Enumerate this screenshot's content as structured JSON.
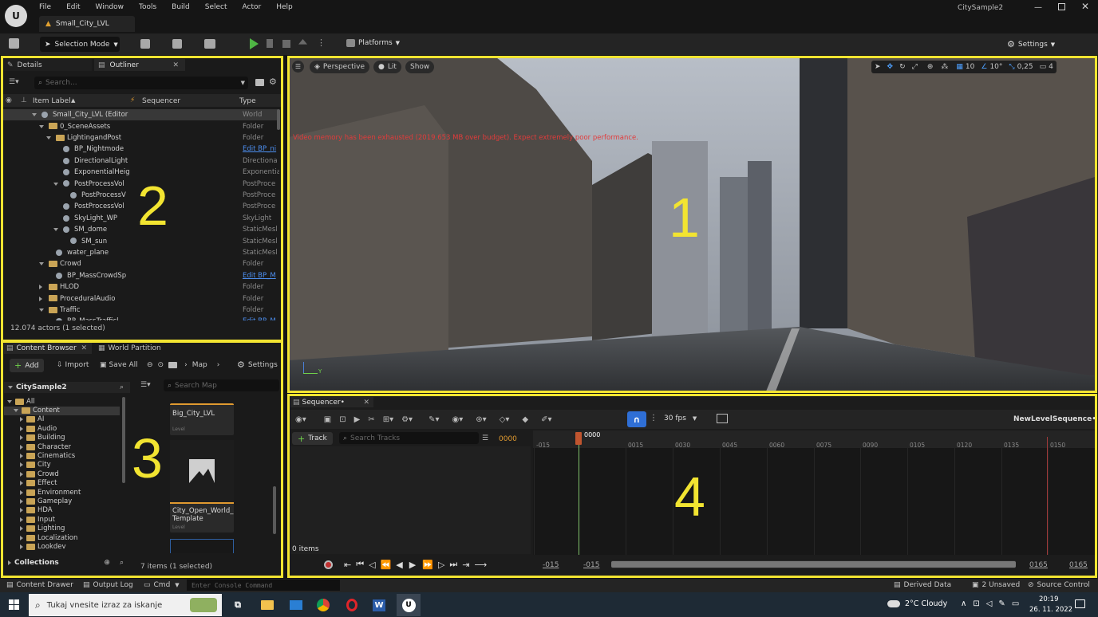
{
  "app": {
    "project_name": "CitySample2",
    "level_tab": "Small_City_LVL"
  },
  "menu": [
    "File",
    "Edit",
    "Window",
    "Tools",
    "Build",
    "Select",
    "Actor",
    "Help"
  ],
  "toolbar": {
    "selection_mode": "Selection Mode",
    "platforms": "Platforms",
    "settings": "Settings"
  },
  "left_panel": {
    "tabs": [
      "Details",
      "Outliner"
    ],
    "search_placeholder": "Search...",
    "columns": [
      "Item Label",
      "Sequencer",
      "Type"
    ],
    "rows": [
      {
        "label": "Small_City_LVL (Editor",
        "type": "World",
        "indent": 0,
        "link": false
      },
      {
        "label": "0_SceneAssets",
        "type": "Folder",
        "indent": 1,
        "link": false
      },
      {
        "label": "LightingandPost",
        "type": "Folder",
        "indent": 2,
        "link": false
      },
      {
        "label": "BP_Nightmode",
        "type": "Edit BP_ni",
        "indent": 3,
        "link": true
      },
      {
        "label": "DirectionalLight",
        "type": "Directiona",
        "indent": 3,
        "link": false
      },
      {
        "label": "ExponentialHeig",
        "type": "Exponentia",
        "indent": 3,
        "link": false
      },
      {
        "label": "PostProcessVol",
        "type": "PostProce",
        "indent": 3,
        "link": false
      },
      {
        "label": "PostProcessV",
        "type": "PostProce",
        "indent": 4,
        "link": false
      },
      {
        "label": "PostProcessVol",
        "type": "PostProce",
        "indent": 3,
        "link": false
      },
      {
        "label": "SkyLight_WP",
        "type": "SkyLight",
        "indent": 3,
        "link": false
      },
      {
        "label": "SM_dome",
        "type": "StaticMesl",
        "indent": 3,
        "link": false
      },
      {
        "label": "SM_sun",
        "type": "StaticMesl",
        "indent": 4,
        "link": false
      },
      {
        "label": "water_plane",
        "type": "StaticMesl",
        "indent": 2,
        "link": false
      },
      {
        "label": "Crowd",
        "type": "Folder",
        "indent": 1,
        "link": false
      },
      {
        "label": "BP_MassCrowdSp",
        "type": "Edit BP_M",
        "indent": 2,
        "link": true
      },
      {
        "label": "HLOD",
        "type": "Folder",
        "indent": 1,
        "link": false
      },
      {
        "label": "ProceduralAudio",
        "type": "Folder",
        "indent": 1,
        "link": false
      },
      {
        "label": "Traffic",
        "type": "Folder",
        "indent": 1,
        "link": false
      },
      {
        "label": "BP_MassTrafficl",
        "type": "Edit BP_M",
        "indent": 2,
        "link": true
      }
    ],
    "status": "12.074 actors (1 selected)"
  },
  "viewport": {
    "perspective": "Perspective",
    "lit": "Lit",
    "show": "Show",
    "warning": "Video memory has been exhausted (2019.653 MB over budget). Expect extremely poor performance.",
    "grid_snap": "10",
    "rot_snap": "10°",
    "scale_snap": "0,25",
    "cam_speed": "4",
    "label": "1"
  },
  "content_browser": {
    "tabs": [
      "Content Browser",
      "World Partition"
    ],
    "add": "Add",
    "import": "Import",
    "save_all": "Save All",
    "path": "Map",
    "settings": "Settings",
    "root": "CitySample2",
    "search_placeholder": "Search Map",
    "tree": [
      "All",
      "Content",
      "AI",
      "Audio",
      "Building",
      "Character",
      "Cinematics",
      "City",
      "Crowd",
      "Effect",
      "Environment",
      "Gameplay",
      "HDA",
      "Input",
      "Lighting",
      "Localization",
      "Lookdev"
    ],
    "collections": "Collections",
    "assets": [
      {
        "name": "Big_City_LVL",
        "type": "Level"
      },
      {
        "name": "City_Open_World_ Template",
        "type": "Level"
      }
    ],
    "status": "7 items (1 selected)",
    "label": "3"
  },
  "sequencer": {
    "tab": "Sequencer•",
    "fps": "30 fps",
    "sequence_name": "NewLevelSequence•",
    "track_btn": "Track",
    "search_placeholder": "Search Tracks",
    "frame": "0000",
    "playhead": "0000",
    "ticks": [
      "-015",
      "0015",
      "0030",
      "0045",
      "0060",
      "0075",
      "0090",
      "0105",
      "0120",
      "0135",
      "0150"
    ],
    "items": "0 items",
    "range_start": "-015",
    "range_start2": "-015",
    "range_end": "0165",
    "range_end2": "0165",
    "label": "4"
  },
  "outliner_label": "2",
  "status_bar": {
    "content_drawer": "Content Drawer",
    "output_log": "Output Log",
    "cmd": "Cmd",
    "console_placeholder": "Enter Console Command",
    "derived_data": "Derived Data",
    "unsaved": "2 Unsaved",
    "source_control": "Source Control"
  },
  "taskbar": {
    "search_placeholder": "Tukaj vnesite izraz za iskanje",
    "weather": "2°C  Cloudy",
    "time": "20:19",
    "date": "26. 11. 2022"
  }
}
